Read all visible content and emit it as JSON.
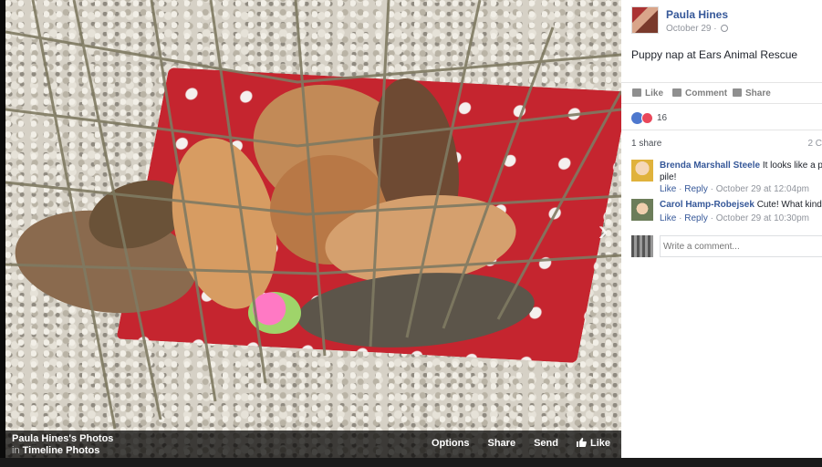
{
  "photo_bar": {
    "album_title": "Paula Hines's Photos",
    "album_in": "in",
    "album_link": "Timeline Photos",
    "options": "Options",
    "share": "Share",
    "send": "Send",
    "like": "Like"
  },
  "post": {
    "author": "Paula Hines",
    "date": "October 29 ·",
    "text": "Puppy nap at Ears Animal Rescue",
    "actions": {
      "like": "Like",
      "comment": "Comment",
      "share": "Share"
    },
    "reaction_count": "16",
    "share_count": "1 share",
    "comment_count": "2 C"
  },
  "comments": [
    {
      "name": "Brenda Marshall Steele",
      "text": " It looks like a puppy",
      "text_cont": "pile!",
      "like": "Like",
      "reply": "Reply",
      "time": "October 29 at 12:04pm"
    },
    {
      "name": "Carol Hamp-Robejsek",
      "text": " Cute! What kind are t",
      "like": "Like",
      "reply": "Reply",
      "time": "October 29 at 10:30pm"
    }
  ],
  "write_comment": {
    "placeholder": "Write a comment..."
  },
  "colors": {
    "link_blue": "#365899",
    "like_blue": "#4e78ce",
    "love_red": "#e9475a"
  },
  "icons": [
    "next-arrow-icon",
    "like-icon",
    "comment-icon",
    "share-icon",
    "globe-icon"
  ]
}
